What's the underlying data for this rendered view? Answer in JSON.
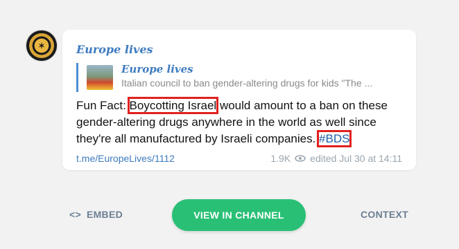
{
  "post": {
    "avatar_icon": "channel-logo-icon",
    "author": "Europe lives",
    "reply": {
      "author": "Europe lives",
      "text": "Italian council to ban gender-altering drugs for kids \"The ..."
    },
    "message": {
      "part1": "Fun Fact: ",
      "highlight1": "Boycotting Israel",
      "part2": " would amount to a ban on these gender-altering drugs anywhere in the world as well since they're all manufactured by Israeli companies. ",
      "hashtag": "#BDS"
    },
    "link": "t.me/EuropeLives/1112",
    "views": "1.9K",
    "edited": "edited  Jul 30 at 14:11"
  },
  "actions": {
    "embed_label": "EMBED",
    "embed_icon": "code-brackets-icon",
    "view_label": "VIEW IN CHANNEL",
    "context_label": "CONTEXT"
  },
  "colors": {
    "accent_green": "#29c076",
    "link_blue": "#3d7bbf",
    "highlight_red": "#e0201e"
  }
}
